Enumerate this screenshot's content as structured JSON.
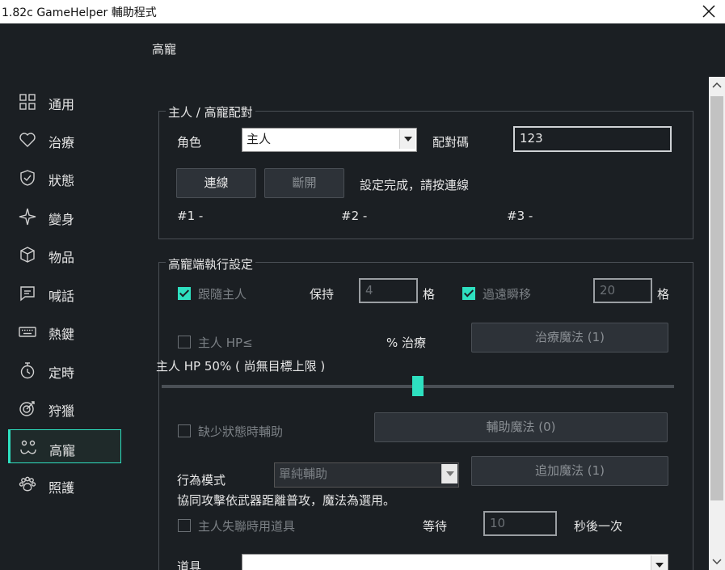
{
  "window": {
    "title": "1.82c GameHelper 輔助程式",
    "close_icon": "close-icon"
  },
  "page_title": "高寵",
  "sidebar": {
    "items": [
      {
        "label": "通用",
        "icon": "grid-icon"
      },
      {
        "label": "治療",
        "icon": "heart-icon"
      },
      {
        "label": "狀態",
        "icon": "shield-icon"
      },
      {
        "label": "變身",
        "icon": "sparkle-icon"
      },
      {
        "label": "物品",
        "icon": "cube-icon"
      },
      {
        "label": "喊話",
        "icon": "chat-icon"
      },
      {
        "label": "熱鍵",
        "icon": "keyboard-icon"
      },
      {
        "label": "定時",
        "icon": "timer-icon"
      },
      {
        "label": "狩獵",
        "icon": "target-icon"
      },
      {
        "label": "高寵",
        "icon": "pet-face-icon",
        "active": true
      },
      {
        "label": "照護",
        "icon": "paw-icon"
      }
    ]
  },
  "pairing": {
    "title": "主人 / 高寵配對",
    "role_label": "角色",
    "role_value": "主人",
    "code_label": "配對碼",
    "code_value": "123",
    "connect_button": "連線",
    "disconnect_button": "斷開",
    "status": "設定完成，請按連線",
    "slot1": "#1 -",
    "slot2": "#2 -",
    "slot3": "#3 -"
  },
  "pet_settings": {
    "title": "高寵端執行設定",
    "follow_label": "跟隨主人",
    "follow_checked": true,
    "keep_label": "保持",
    "keep_value": "4",
    "grid_unit": "格",
    "teleport_label": "過遠瞬移",
    "teleport_checked": true,
    "teleport_value": "20",
    "teleport_unit": "格",
    "hp_check_label": "主人 HP≤",
    "hp_percent_label": "% 治療",
    "heal_magic_button": "治療魔法 (1)",
    "hp_slider_label": "主人 HP  50% ( 尚無目標上限 )",
    "hp_slider_value": 50,
    "assist_label": "缺少狀態時輔助",
    "assist_magic_button": "輔助魔法 (0)",
    "behavior_label": "行為模式",
    "behavior_value": "單純輔助",
    "add_magic_button": "追加魔法 (1)",
    "coop_note": "協同攻擊依武器距離普攻，魔法為選用。",
    "lost_item_label": "主人失聯時用道具",
    "wait_label": "等待",
    "wait_value": "10",
    "wait_suffix": "秒後一次",
    "item_label": "道具"
  },
  "colors": {
    "accent": "#2ee0c0",
    "background": "#1b1f23"
  }
}
